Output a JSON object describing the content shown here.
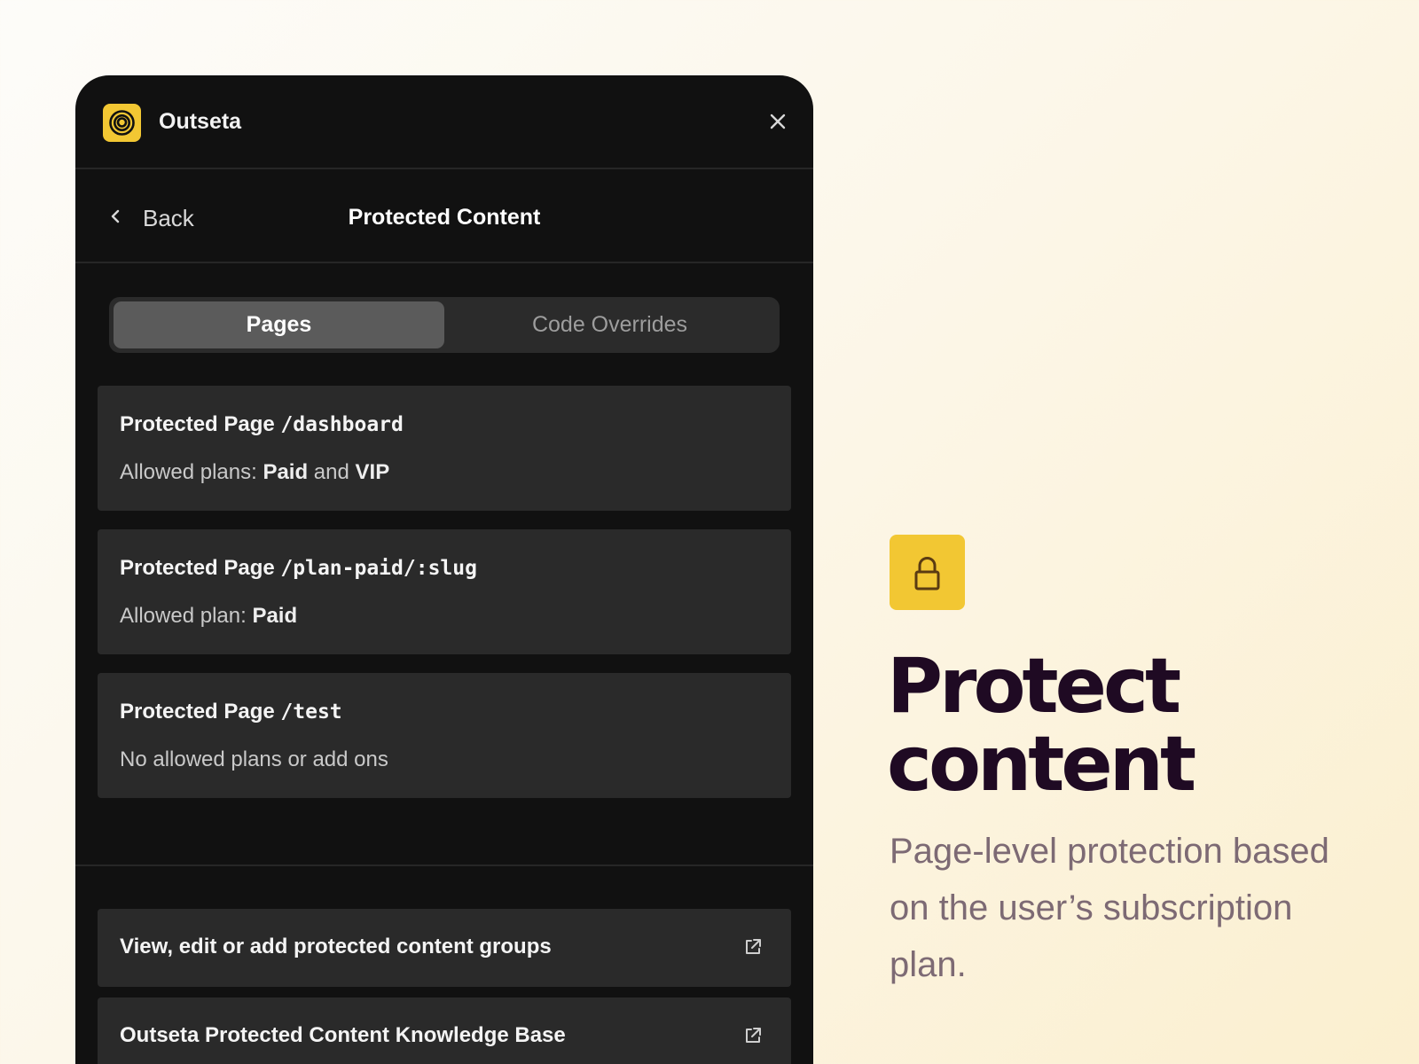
{
  "app": {
    "name": "Outseta"
  },
  "navbar": {
    "back_label": "Back",
    "title": "Protected Content"
  },
  "tabs": [
    {
      "label": "Pages",
      "active": true
    },
    {
      "label": "Code Overrides",
      "active": false
    }
  ],
  "pages": [
    {
      "prefix": "Protected Page",
      "path": "/dashboard",
      "sub_text": "Allowed plans: ",
      "plans": [
        "Paid",
        "VIP"
      ],
      "joiner": " and "
    },
    {
      "prefix": "Protected Page",
      "path": "/plan-paid/:slug",
      "sub_text": "Allowed plan: ",
      "plans": [
        "Paid"
      ],
      "joiner": ""
    },
    {
      "prefix": "Protected Page",
      "path": "/test",
      "sub_text": "No allowed plans or add ons",
      "plans": [],
      "joiner": ""
    }
  ],
  "links": [
    {
      "label": "View, edit or add protected content groups"
    },
    {
      "label": "Outseta Protected Content Knowledge Base"
    }
  ],
  "promo": {
    "headline_line1": "Protect",
    "headline_line2": "content",
    "subtext": "Page-level protection based on the user’s subscription plan."
  },
  "colors": {
    "accent": "#f2c733",
    "panel_bg": "#111111",
    "card_bg": "#2a2a2a",
    "headline": "#1f0a23",
    "subtext": "#7d6a74"
  },
  "icons": {
    "logo": "outseta-logo-icon",
    "close": "close-icon",
    "back": "chevron-left-icon",
    "external": "external-link-icon",
    "lock": "lock-icon"
  }
}
